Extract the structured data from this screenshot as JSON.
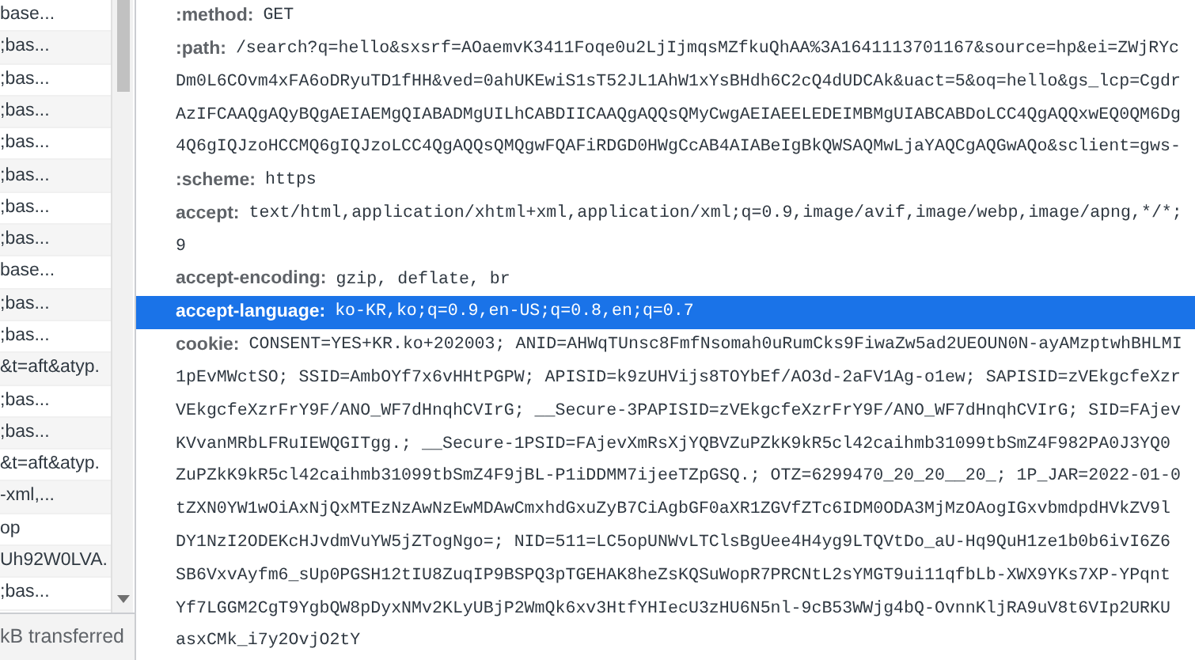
{
  "requests": [
    {
      "name": "base..."
    },
    {
      "name": ";bas..."
    },
    {
      "name": ";bas..."
    },
    {
      "name": ";bas..."
    },
    {
      "name": ";bas..."
    },
    {
      "name": ";bas..."
    },
    {
      "name": ";bas..."
    },
    {
      "name": ";bas..."
    },
    {
      "name": "base..."
    },
    {
      "name": ";bas..."
    },
    {
      "name": ";bas..."
    },
    {
      "name": "&t=aft&atyp."
    },
    {
      "name": ";bas..."
    },
    {
      "name": ";bas..."
    },
    {
      "name": "&t=aft&atyp."
    },
    {
      "name": "-xml,..."
    },
    {
      "name": "op"
    },
    {
      "name": "Uh92W0LVA."
    },
    {
      "name": ";bas..."
    }
  ],
  "summary": "kB transferred",
  "headers": [
    {
      "key": ":method:",
      "lines": [
        "GET"
      ],
      "selected": false
    },
    {
      "key": ":path:",
      "lines": [
        "/search?q=hello&sxsrf=AOaemvK3411Foqe0u2LjIjmqsMZfkuQhAA%3A1641113701167&source=hp&ei=ZWjRYc",
        "Dm0L6COvm4xFA6oDRyuTD1fHH&ved=0ahUKEwiS1sT52JL1AhW1xYsBHdh6C2cQ4dUDCAk&uact=5&oq=hello&gs_lcp=Cgdr",
        "AzIFCAAQgAQyBQgAEIAEMgQIABADMgUILhCABDIICAAQgAQQsQMyCwgAEIAEELEDEIMBMgUIABCABDoLCC4QgAQQxwEQ0QM6Dg",
        "4Q6gIQJzoHCCMQ6gIQJzoLCC4QgAQQsQMQgwFQAFiRDGD0HWgCcAB4AIABeIgBkQWSAQMwLjaYAQCgAQGwAQo&sclient=gws-"
      ],
      "selected": false
    },
    {
      "key": ":scheme:",
      "lines": [
        "https"
      ],
      "selected": false
    },
    {
      "key": "accept:",
      "lines": [
        "text/html,application/xhtml+xml,application/xml;q=0.9,image/avif,image/webp,image/apng,*/*;",
        "9"
      ],
      "selected": false
    },
    {
      "key": "accept-encoding:",
      "lines": [
        "gzip, deflate, br"
      ],
      "selected": false
    },
    {
      "key": "accept-language:",
      "lines": [
        "ko-KR,ko;q=0.9,en-US;q=0.8,en;q=0.7"
      ],
      "selected": true
    },
    {
      "key": "cookie:",
      "lines": [
        "CONSENT=YES+KR.ko+202003; ANID=AHWqTUnsc8FmfNsomah0uRumCks9FiwaZw5ad2UEOUN0N-ayAMzptwhBHLMI",
        "1pEvMWctSO; SSID=AmbOYf7x6vHHtPGPW; APISID=k9zUHVijs8TOYbEf/AO3d-2aFV1Ag-o1ew; SAPISID=zVEkgcfeXzr",
        "VEkgcfeXzrFrY9F/ANO_WF7dHnqhCVIrG; __Secure-3PAPISID=zVEkgcfeXzrFrY9F/ANO_WF7dHnqhCVIrG; SID=FAjev",
        "KVvanMRbLFRuIEWQGITgg.; __Secure-1PSID=FAjevXmRsXjYQBVZuPZkK9kR5cl42caihmb31099tbSmZ4F982PA0J3YQ0",
        "ZuPZkK9kR5cl42caihmb31099tbSmZ4F9jBL-P1iDDMM7ijeeTZpGSQ.; OTZ=6299470_20_20__20_; 1P_JAR=2022-01-0",
        "tZXN0YW1wOiAxNjQxMTEzNzAwNzEwMDAwCmxhdGxuZyB7CiAgbGF0aXR1ZGVfZTc6IDM0ODA3MjMzOAogIGxvbmdpdHVkZV9l",
        "DY1NzI2ODEKcHJvdmVuYW5jZTogNgo=; NID=511=LC5opUNWvLTClsBgUee4H4yg9LTQVtDo_aU-Hq9QuH1ze1b0b6ivI6Z6",
        "SB6VxvAyfm6_sUp0PGSH12tIU8ZuqIP9BSPQ3pTGEHAK8heZsKQSuWopR7PRCNtL2sYMGT9ui11qfbLb-XWX9YKs7XP-YPqnt",
        "Yf7LGGM2CgT9YgbQW8pDyxNMv2KLyUBjP2WmQk6xv3HtfYHIecU3zHU6N5nl-9cB53WWjg4bQ-OvnnKljRA9uV8t6VIp2URKU",
        "asxCMk_i7y2OvjO2tY"
      ],
      "selected": false
    }
  ]
}
